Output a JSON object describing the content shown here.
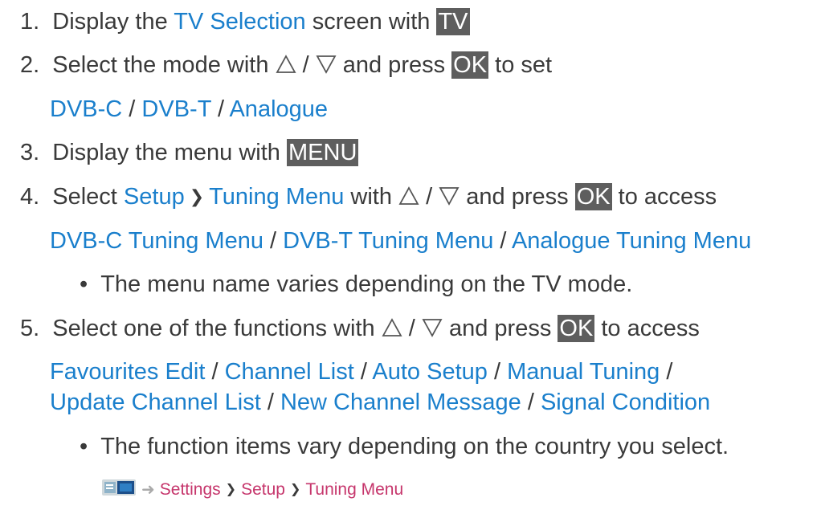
{
  "step1": {
    "num": "1.",
    "pre": "Display the ",
    "link": "TV Selection",
    "mid": " screen with ",
    "key": "TV"
  },
  "step2": {
    "num": "2.",
    "pre": "Select the mode with ",
    "sep": " / ",
    "mid": " and press ",
    "key": "OK",
    "post": " to set"
  },
  "step2_opts": {
    "a": "DVB-C",
    "b": "DVB-T",
    "c": "Analogue",
    "sep": " / "
  },
  "step3": {
    "num": "3.",
    "pre": "Display the menu with ",
    "key": "MENU"
  },
  "step4": {
    "num": "4.",
    "pre": "Select ",
    "link1": "Setup",
    "link2": "Tuning Menu",
    "mid": " with ",
    "sep": " / ",
    "mid2": " and press ",
    "key": "OK",
    "post": " to access"
  },
  "step4_opts": {
    "a": "DVB-C Tuning Menu",
    "b": "DVB-T Tuning Menu",
    "c": "Analogue Tuning Menu",
    "sep": " / "
  },
  "step4_note": {
    "bullet": "•",
    "text": "The menu name varies depending on the TV mode."
  },
  "step5": {
    "num": "5.",
    "pre": "Select one of the functions with ",
    "sep": " / ",
    "mid": " and press ",
    "key": "OK",
    "post": " to access"
  },
  "step5_opts1": {
    "a": "Favourites Edit",
    "b": "Channel List",
    "c": "Auto Setup",
    "d": "Manual Tuning",
    "sep": " / ",
    "trail": " /"
  },
  "step5_opts2": {
    "a": "Update Channel List",
    "b": "New Channel Message",
    "c": "Signal Condition",
    "sep": " / "
  },
  "step5_note": {
    "bullet": "•",
    "text": "The function items vary depending on the country you select."
  },
  "path": {
    "a": "Settings",
    "b": "Setup",
    "c": "Tuning Menu"
  },
  "colors": {
    "link": "#1a7fcc",
    "key_bg": "#5e5e5e",
    "path_link": "#c6366c",
    "text": "#3a3a3a"
  },
  "icons": {
    "up": "triangle-up-icon",
    "down": "triangle-down-icon",
    "chevron": "chevron-right-icon",
    "home": "ehelp-home-icon",
    "arrow": "arrow-right-icon"
  }
}
